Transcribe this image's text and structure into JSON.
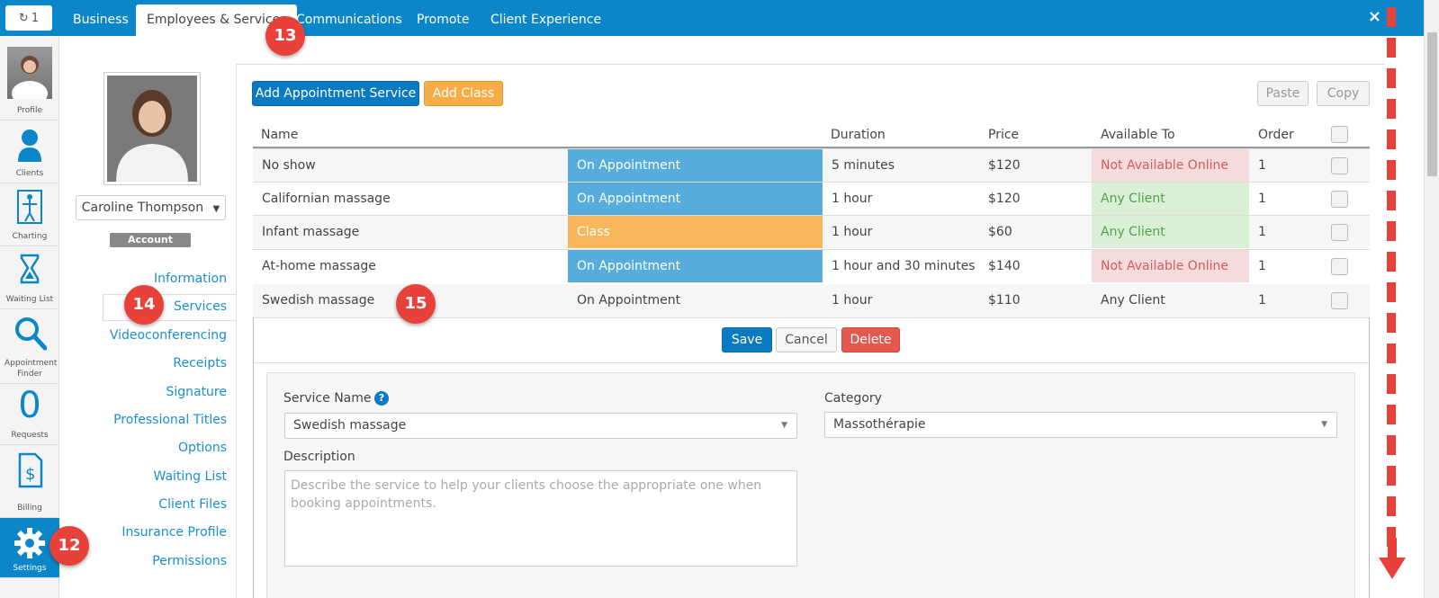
{
  "topbar": {
    "refresh_label": "1",
    "tabs": [
      {
        "label": "Business"
      },
      {
        "label": "Employees & Services"
      },
      {
        "label": "Communications"
      },
      {
        "label": "Promote"
      },
      {
        "label": "Client Experience"
      }
    ],
    "close_label": "×"
  },
  "rail": {
    "items": [
      {
        "label": "Profile"
      },
      {
        "label": "Clients"
      },
      {
        "label": "Charting"
      },
      {
        "label": "Waiting List"
      },
      {
        "label": "Appointment Finder"
      },
      {
        "label": "Requests",
        "count": "0"
      },
      {
        "label": "Billing"
      },
      {
        "label": "Settings"
      }
    ]
  },
  "profile": {
    "name": "Caroline Thompson",
    "badge": "Account Owner"
  },
  "side_menu": [
    {
      "label": "Information"
    },
    {
      "label": "Services"
    },
    {
      "label": "Videoconferencing"
    },
    {
      "label": "Receipts"
    },
    {
      "label": "Signature"
    },
    {
      "label": "Professional Titles"
    },
    {
      "label": "Options"
    },
    {
      "label": "Waiting List"
    },
    {
      "label": "Client Files"
    },
    {
      "label": "Insurance Profile"
    },
    {
      "label": "Permissions"
    }
  ],
  "toolbar": {
    "add_appointment": "Add Appointment Service",
    "add_class": "Add Class",
    "paste": "Paste",
    "copy": "Copy"
  },
  "table": {
    "headers": [
      "Name",
      "Duration",
      "Price",
      "Available To",
      "Order"
    ],
    "rows": [
      {
        "name": "No show",
        "category": "On Appointment",
        "duration": "5 minutes",
        "price": "$120",
        "available": "Not Available Online",
        "order": "1"
      },
      {
        "name": "Californian massage",
        "category": "On Appointment",
        "duration": "1 hour",
        "price": "$120",
        "available": "Any Client",
        "order": "1"
      },
      {
        "name": "Infant massage",
        "category": "Class",
        "duration": "1 hour",
        "price": "$60",
        "available": "Any Client",
        "order": "1"
      },
      {
        "name": "At-home massage",
        "category": "On Appointment",
        "duration": "1 hour and 30 minutes",
        "price": "$140",
        "available": "Not Available Online",
        "order": "1"
      },
      {
        "name": "Swedish massage",
        "category": "On Appointment",
        "duration": "1 hour",
        "price": "$110",
        "available": "Any Client",
        "order": "1"
      }
    ]
  },
  "edit": {
    "save": "Save",
    "cancel": "Cancel",
    "delete": "Delete",
    "service_name_label": "Service Name",
    "service_name_value": "Swedish massage",
    "category_label": "Category",
    "category_value": "Massothérapie",
    "description_label": "Description",
    "description_placeholder": "Describe the service to help your clients choose the appropriate one when booking appointments."
  },
  "markers": {
    "m12": "12",
    "m13": "13",
    "m14": "14",
    "m15": "15"
  },
  "colors": {
    "brand": "#0b87c9",
    "appointment": "#56acdc",
    "class": "#f9b55a",
    "not_available_bg": "#f5dcdc",
    "any_client_bg": "#dbefd7",
    "marker": "#e8413a"
  }
}
